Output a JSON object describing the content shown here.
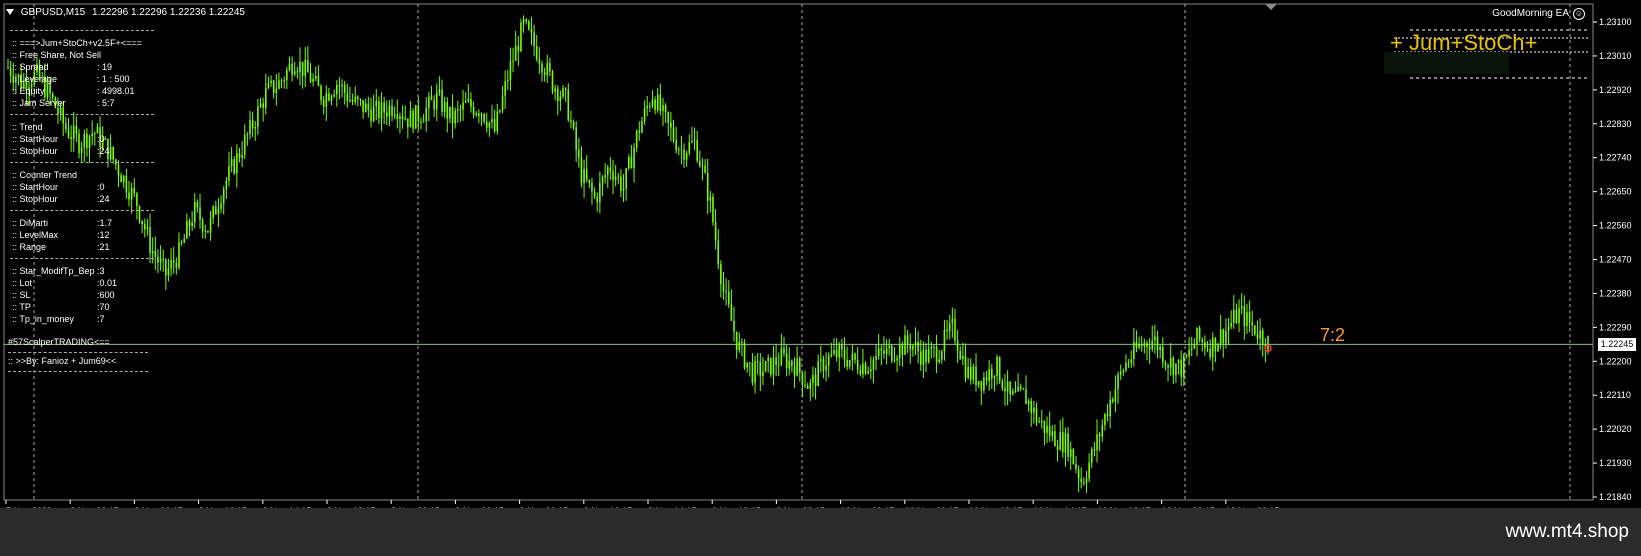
{
  "header": {
    "symbol": "GBPUSD,M15",
    "ohlc": "1.22296 1.22296 1.22236 1.22245"
  },
  "ea_label": "GoodMorning EA",
  "info_panel": {
    "title": ":: ===>Jum+StoCh+v2.5F+<===",
    "subtitle": ":: Free Share, Not Sell",
    "rows": [
      {
        "label": ":: Spread",
        "value": ": 19"
      },
      {
        "label": ":: Leverage",
        "value": ": 1 : 500"
      },
      {
        "label": ":: Equity",
        "value": ": 4998.01"
      },
      {
        "label": ":: Jam Server",
        "value": ": 5:7"
      }
    ],
    "trend_title": ":: Trend",
    "trend": [
      {
        "label": ":: StartHour",
        "value": ":0"
      },
      {
        "label": ":: StopHour",
        "value": ":24"
      }
    ],
    "counter_title": ":: Counter Trend",
    "counter": [
      {
        "label": ":: StartHour",
        "value": ":0"
      },
      {
        "label": ":: StopHour",
        "value": ":24"
      }
    ],
    "params1": [
      {
        "label": ":: DiMarti",
        "value": ":1.7"
      },
      {
        "label": ":: LevelMax",
        "value": ":12"
      },
      {
        "label": ":: Range",
        "value": ":21"
      }
    ],
    "params2": [
      {
        "label": ":: Star_ModifTp_Bep",
        "value": ":3"
      },
      {
        "label": ":: Lot",
        "value": ":0.01"
      },
      {
        "label": ":: SL",
        "value": ":600"
      },
      {
        "label": ":: TP",
        "value": ":70"
      },
      {
        "label": ":: Tp_in_money",
        "value": ":7"
      }
    ],
    "overlap_text": "#57ScalperTRADING<==",
    "author": ":: >>By: Fanioz + Jum69<<"
  },
  "overlay_text": "+ Jum+StoCh+",
  "countdown": "7:2",
  "current_price": "1.22245",
  "price_axis": [
    "1.23100",
    "1.23010",
    "1.22920",
    "1.22830",
    "1.22740",
    "1.22650",
    "1.22560",
    "1.22470",
    "1.22380",
    "1.22290",
    "1.22200",
    "1.22110",
    "1.22020",
    "1.21930",
    "1.21840"
  ],
  "time_axis": [
    "7 Nov 2023",
    "8 Nov 02:15",
    "8 Nov 06:15",
    "8 Nov 10:15",
    "8 Nov 14:15",
    "8 Nov 18:15",
    "8 Nov 22:15",
    "9 Nov 02:15",
    "9 Nov 06:15",
    "9 Nov 10:15",
    "9 Nov 14:15",
    "9 Nov 18:15",
    "9 Nov 22:15",
    "10 Nov 02:15",
    "10 Nov 06:15",
    "10 Nov 10:15",
    "10 Nov 14:15",
    "10 Nov 18:15",
    "10 Nov 22:15",
    "13 Nov 02:15"
  ],
  "watermark": "www.mt4.shop",
  "colors": {
    "candle": "#7CFC00",
    "background": "#000000",
    "bid_line": "#8fbc8f",
    "overlay": "#ffd700",
    "countdown": "#ff9933"
  },
  "series_shape": [
    1.2298,
    1.2294,
    1.2296,
    1.229,
    1.2282,
    1.2278,
    1.2281,
    1.2276,
    1.2269,
    1.2262,
    1.225,
    1.2243,
    1.2249,
    1.226,
    1.2255,
    1.2266,
    1.2274,
    1.2282,
    1.2291,
    1.2294,
    1.23,
    1.2296,
    1.229,
    1.2294,
    1.2289,
    1.2287,
    1.2286,
    1.2288,
    1.2284,
    1.2286,
    1.229,
    1.2284,
    1.2288,
    1.2287,
    1.2281,
    1.2297,
    1.2309,
    1.2302,
    1.2294,
    1.2289,
    1.227,
    1.2263,
    1.2272,
    1.2266,
    1.2281,
    1.2291,
    1.2283,
    1.2276,
    1.2278,
    1.2263,
    1.2238,
    1.2224,
    1.2217,
    1.2218,
    1.2221,
    1.2219,
    1.2213,
    1.222,
    1.2222,
    1.222,
    1.2219,
    1.2222,
    1.2223,
    1.2225,
    1.2221,
    1.2223,
    1.2229,
    1.2217,
    1.2215,
    1.2219,
    1.221,
    1.2211,
    1.2204,
    1.22,
    1.2198,
    1.2188,
    1.2198,
    1.221,
    1.2219,
    1.2224,
    1.2226,
    1.222,
    1.2218,
    1.2226,
    1.2224,
    1.2228,
    1.2233,
    1.2229,
    1.2225
  ]
}
